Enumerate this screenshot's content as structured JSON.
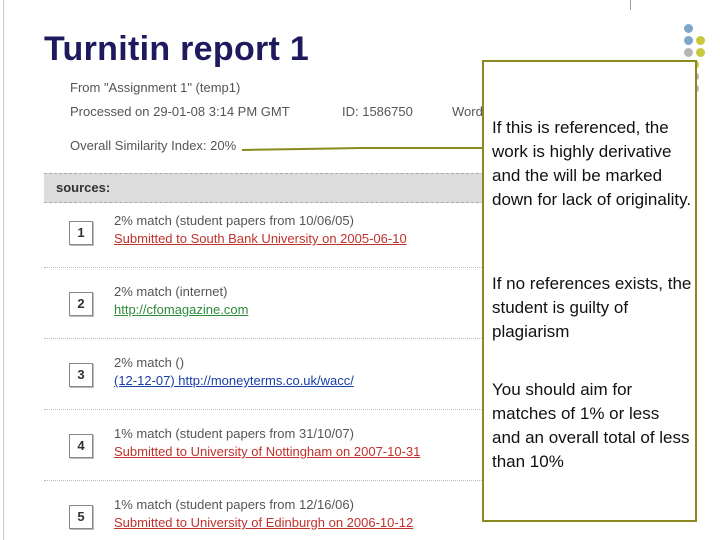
{
  "slide": {
    "title": "Turnitin report 1"
  },
  "report": {
    "from": "From \"Assignment 1\" (temp1)",
    "processed": "Processed on 29-01-08 3:14 PM GMT",
    "id": "ID: 1586750",
    "word_partial": "Word",
    "similarity": "Overall Similarity Index: 20%",
    "sources_label": "sources:",
    "sources": [
      {
        "num": "1",
        "match": "2% match (student papers from 10/06/05)",
        "link": "Submitted to South Bank University on 2005-06-10",
        "link_color": "#c0322c"
      },
      {
        "num": "2",
        "match": "2% match (internet)",
        "link": "http://cfomagazine.com",
        "link_color": "#2c8a3a"
      },
      {
        "num": "3",
        "match": "2% match ()",
        "link": "(12-12-07) http://moneyterms.co.uk/wacc/",
        "link_color": "#1a3fa6"
      },
      {
        "num": "4",
        "match": "1% match (student papers from 31/10/07)",
        "link": "Submitted to University of Nottingham on 2007-10-31",
        "link_color": "#c0322c"
      },
      {
        "num": "5",
        "match": "1% match (student papers from 12/16/06)",
        "link": "Submitted to University of Edinburgh on 2006-10-12",
        "link_color": "#c0322c"
      }
    ]
  },
  "callout": {
    "p1": "If this is referenced, the work is highly derivative and the will be marked down for lack of originality.",
    "p2": "If no references exists, the student is guilty of plagiarism",
    "p3": "You should aim for matches of 1% or less and an overall total of less than 10%"
  },
  "colors": {
    "title": "#1f1a5e",
    "callout_border": "#8a8a20",
    "dot_blue": "#7ea6c9",
    "dot_yellow": "#c8c83c",
    "dot_gray": "#b5b5b5"
  }
}
